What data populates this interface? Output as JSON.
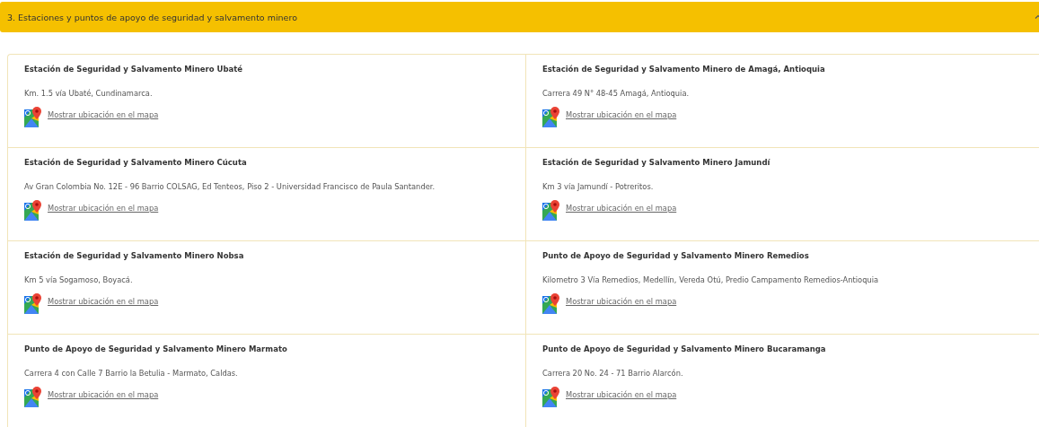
{
  "section": {
    "title": "3. Estaciones y puntos de apoyo de seguridad y salvamento minero",
    "expanded": true
  },
  "stations": [
    {
      "name": "Estación de Seguridad y Salvamento Minero Ubaté",
      "address": "Km. 1.5 vía Ubaté, Cundinamarca.",
      "link": "Mostrar ubicación en el mapa"
    },
    {
      "name": "Estación de Seguridad y Salvamento Minero de Amagá, Antioquia",
      "address": "Carrera 49 N° 48-45 Amagá, Antioquia.",
      "link": "Mostrar ubicación en el mapa"
    },
    {
      "name": "Estación de Seguridad y Salvamento Minero Cúcuta",
      "address": "Av Gran Colombia No. 12E - 96 Barrio COLSAG, Ed Tenteos, Piso 2 - Universidad Francisco de Paula Santander.",
      "link": "Mostrar ubicación en el mapa"
    },
    {
      "name": "Estación de Seguridad y Salvamento Minero Jamundí",
      "address": "Km 3 vía Jamundí - Potreritos.",
      "link": "Mostrar ubicación en el mapa"
    },
    {
      "name": "Estación de Seguridad y Salvamento Minero Nobsa",
      "address": "Km 5 vía Sogamoso, Boyacá.",
      "link": "Mostrar ubicación en el mapa"
    },
    {
      "name": "Punto de Apoyo de Seguridad y Salvamento Minero Remedios",
      "address": "Kilometro 3 Vía Remedios, Medellín, Vereda Otú, Predio Campamento Remedios-Antioquia",
      "link": "Mostrar ubicación en el mapa"
    },
    {
      "name": "Punto de Apoyo de Seguridad y Salvamento Minero Marmato",
      "address": "Carrera 4 con Calle 7 Barrio la Betulia - Marmato, Caldas.",
      "link": "Mostrar ubicación en el mapa"
    },
    {
      "name": "Punto de Apoyo de Seguridad y Salvamento Minero Bucaramanga",
      "address": "Carrera 20 No. 24 - 71 Barrio Alarcón.",
      "link": "Mostrar ubicación en el mapa"
    }
  ]
}
